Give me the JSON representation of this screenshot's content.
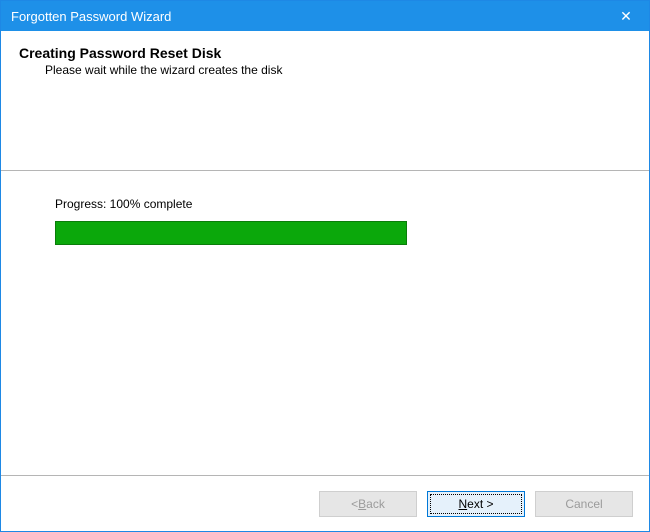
{
  "titlebar": {
    "title": "Forgotten Password Wizard",
    "close_glyph": "✕"
  },
  "header": {
    "title": "Creating Password Reset Disk",
    "subtitle": "Please wait while the wizard creates the disk"
  },
  "content": {
    "progress_label": "Progress: 100% complete",
    "progress_percent": 100
  },
  "footer": {
    "back_prefix": "< ",
    "back_hotkey": "B",
    "back_rest": "ack",
    "next_hotkey": "N",
    "next_rest": "ext >",
    "cancel_label": "Cancel",
    "back_enabled": false,
    "next_enabled": true,
    "cancel_enabled": false
  }
}
